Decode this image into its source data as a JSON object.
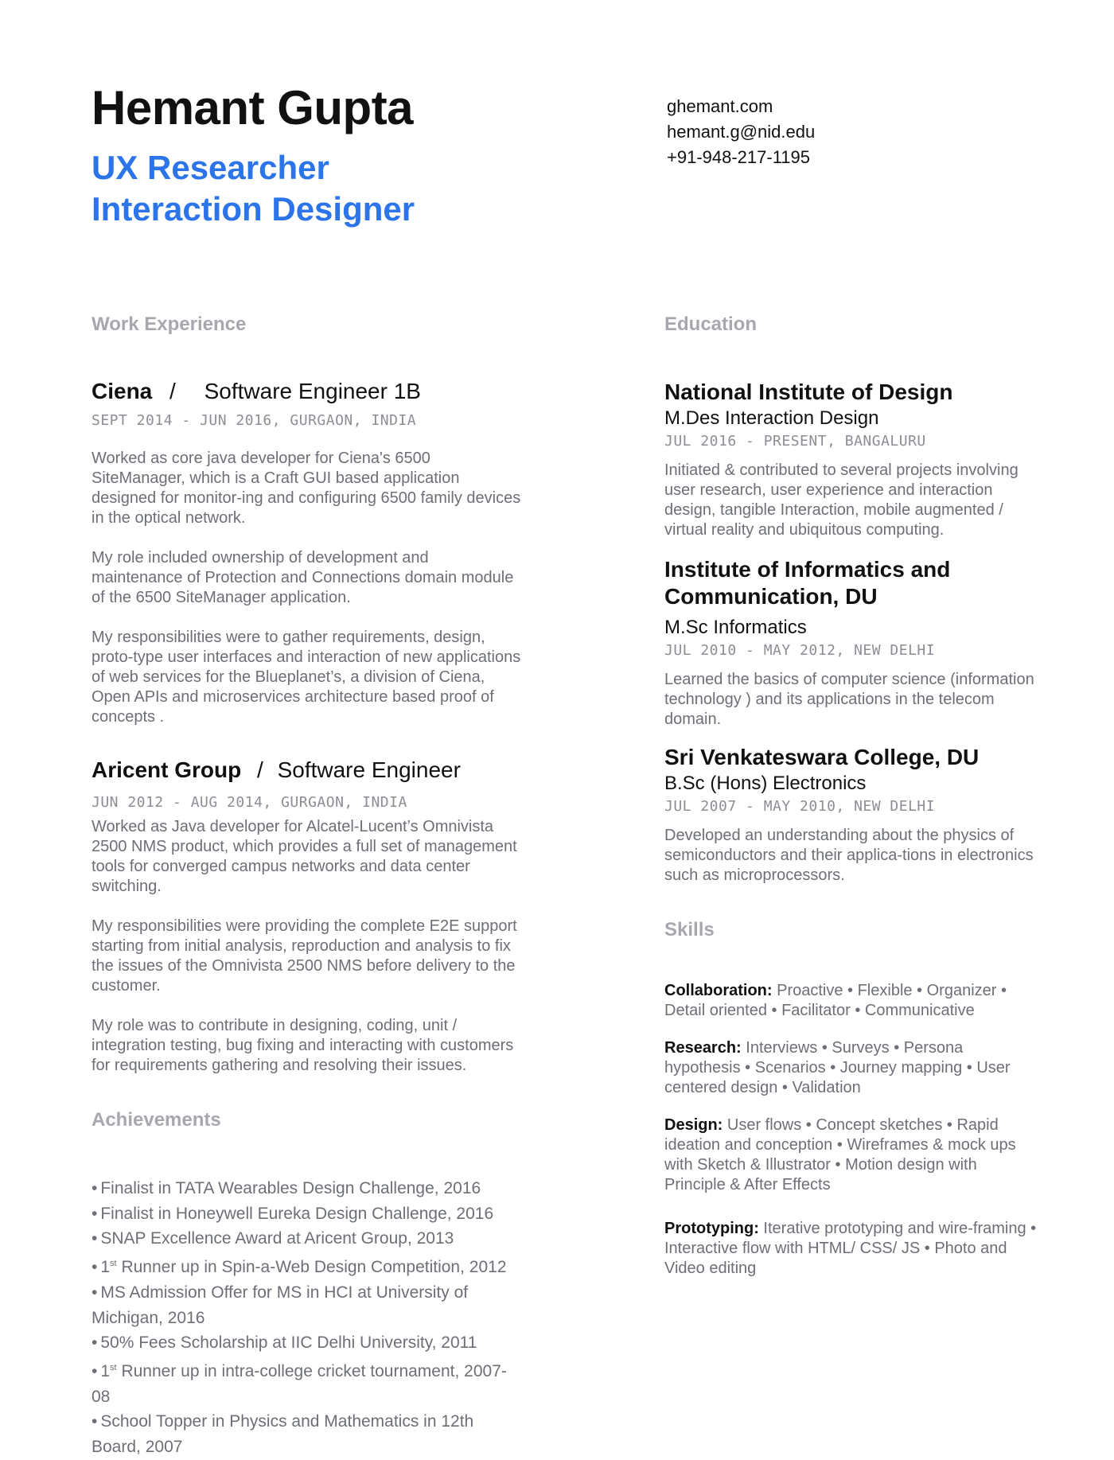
{
  "header": {
    "name": "Hemant Gupta",
    "role_1": "UX Researcher",
    "role_2": "Interaction Designer"
  },
  "contact": {
    "website": "ghemant.com",
    "email": "hemant.g@nid.edu",
    "phone": "+91-948-217-1195"
  },
  "work": {
    "title": "Work Experience",
    "jobs": [
      {
        "company": "Ciena",
        "separator": "/",
        "position": "Software Engineer 1B",
        "dates": "SEPT 2014 - JUN 2016, GURGAON, INDIA",
        "paragraphs": [
          "Worked as core java developer for Ciena's 6500 SiteManager, which is a Craft GUI based application designed for monitor-ing and configuring 6500 family devices in the optical network.",
          "My role included ownership of development and maintenance of Protection and Connections domain module of the 6500 SiteManager application.",
          "My responsibilities were to gather requirements, design, proto-type user interfaces and interaction of new applications of web services for the Blueplanet’s, a division of Ciena, Open APIs and microservices architecture based proof of concepts ."
        ]
      },
      {
        "company": "Aricent Group",
        "separator": "/",
        "position": "Software Engineer",
        "dates": "JUN 2012 - AUG 2014, GURGAON, INDIA",
        "paragraphs": [
          "Worked as Java developer for Alcatel-Lucent’s Omnivista 2500 NMS product, which provides a full set of management tools for converged campus networks and data center switching.",
          "My responsibilities were providing the complete E2E support starting from initial analysis, reproduction and analysis to fix the issues of the Omnivista 2500 NMS before delivery to the customer.",
          "My role was to contribute in designing, coding, unit / integration testing, bug fixing and  interacting with customers for requirements gathering and resolving their issues."
        ]
      }
    ]
  },
  "achievements": {
    "title": "Achievements",
    "bullet": "•",
    "superscript": "st",
    "items": [
      {
        "pre": "Finalist in TATA Wearables Design Challenge, 2016"
      },
      {
        "pre": "Finalist in Honeywell Eureka Design Challenge, 2016"
      },
      {
        "pre": "SNAP Excellence Award at Aricent Group, 2013"
      },
      {
        "pre": "1",
        "post": " Runner up in Spin-a-Web Design Competition, 2012"
      },
      {
        "pre": "MS Admission Offer for MS in HCI at University of Michigan, 2016"
      },
      {
        "pre": "50% Fees Scholarship at IIC Delhi University, 2011"
      },
      {
        "pre": "1",
        "post": " Runner up in intra-college cricket tournament, 2007-08"
      },
      {
        "pre": "School Topper in Physics and Mathematics in 12th Board, 2007"
      }
    ]
  },
  "education": {
    "title": "Education",
    "items": [
      {
        "institute": "National Institute of Design",
        "degree": "M.Des Interaction Design",
        "dates": "JUL 2016 - PRESENT, BANGALURU",
        "desc": "Initiated & contributed to several projects involving user research, user experience and interaction design, tangible Interaction, mobile augmented / virtual reality and ubiquitous computing."
      },
      {
        "institute": "Institute of Informatics and Communication, DU",
        "degree": "M.Sc Informatics",
        "dates": "JUL 2010 - MAY 2012, NEW DELHI",
        "desc": "Learned the basics of computer science (information technology ) and its applications in the telecom domain."
      },
      {
        "institute": "Sri Venkateswara College, DU",
        "degree": "B.Sc (Hons) Electronics",
        "dates": "JUL 2007 - MAY 2010, NEW DELHI",
        "desc": "Developed an understanding about the physics of semiconductors and their applica-tions in electronics such as microprocessors."
      }
    ]
  },
  "skills": {
    "title": "Skills",
    "groups": [
      {
        "label": "Collaboration:",
        "text": " Proactive • Flexible • Organizer • Detail oriented • Facilitator • Communicative"
      },
      {
        "label": "Research:",
        "text": " Interviews • Surveys • Persona hypothesis • Scenarios • Journey mapping • User centered design • Validation"
      },
      {
        "label": "Design:",
        "text": " User flows •  Concept sketches • Rapid ideation and conception  • Wireframes & mock ups with Sketch & Illustrator • Motion design with Principle & After Effects"
      },
      {
        "label": "Prototyping:",
        "text": " Iterative prototyping and wire-framing • Interactive flow with HTML/ CSS/ JS  • Photo and Video editing"
      }
    ]
  }
}
